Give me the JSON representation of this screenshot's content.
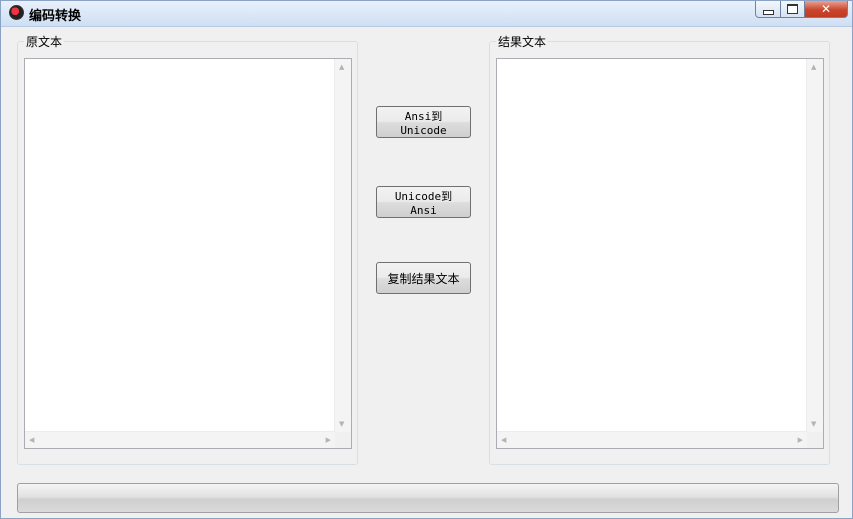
{
  "window": {
    "title": "编码转换",
    "minimize_icon": "minimize-icon",
    "maximize_icon": "maximize-icon",
    "close_glyph": "✕"
  },
  "source": {
    "label": "原文本",
    "value": ""
  },
  "result": {
    "label": "结果文本",
    "value": ""
  },
  "buttons": {
    "ansi_to_unicode": "Ansi到Unicode",
    "unicode_to_ansi": "Unicode到Ansi",
    "copy_result": "复制结果文本"
  },
  "progress": {
    "value": 0
  },
  "colors": {
    "accent": "#37b637",
    "titlebar": "#d8e6f6",
    "close": "#c9462c"
  }
}
